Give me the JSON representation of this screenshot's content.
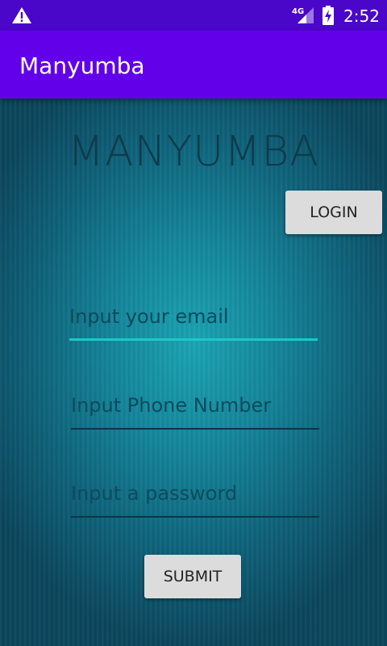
{
  "status_bar": {
    "network": "4G",
    "time": "2:52",
    "icons": [
      "warning-icon",
      "signal-icon",
      "battery-charging-icon"
    ]
  },
  "app_bar": {
    "title": "Manyumba"
  },
  "main": {
    "logo_text": "MANYUMBA",
    "login_button": "LOGIN",
    "email_placeholder": "Input your email",
    "phone_placeholder": "Input Phone Number",
    "password_placeholder": "Input a password",
    "submit_button": "SUBMIT"
  },
  "colors": {
    "app_bar": "#6200ea",
    "status_bar": "#4a06c9",
    "focus_accent": "#19c9c6"
  }
}
